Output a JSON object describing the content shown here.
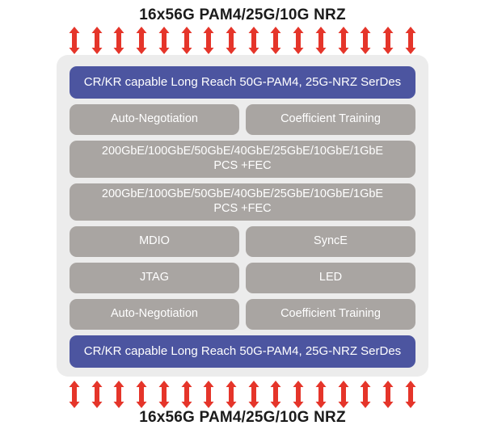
{
  "labels": {
    "top": "16x56G PAM4/25G/10G NRZ",
    "bottom": "16x56G PAM4/25G/10G NRZ"
  },
  "arrows": {
    "icon": "double-arrow-up-down-icon",
    "count": 16,
    "color": "#e5352a",
    "top_row_count": 16,
    "bottom_row_count": 16
  },
  "colors": {
    "serdes_block": "#4c55a0",
    "gray_block": "#a9a5a2",
    "chip_background": "#ececec",
    "arrow_red": "#e5352a",
    "page_background": "#ffffff",
    "label_text": "#1b1b1b",
    "block_text": "#ffffff"
  },
  "chip": {
    "rows": [
      {
        "type": "serdes",
        "blocks": [
          {
            "label": "CR/KR capable Long Reach 50G-PAM4, 25G-NRZ SerDes"
          }
        ]
      },
      {
        "type": "pair",
        "blocks": [
          {
            "label": "Auto-Negotiation"
          },
          {
            "label": "Coefficient Training"
          }
        ]
      },
      {
        "type": "full",
        "blocks": [
          {
            "label": "200GbE/100GbE/50GbE/40GbE/25GbE/10GbE/1GbE",
            "label_line2": "PCS +FEC"
          }
        ]
      },
      {
        "type": "full",
        "blocks": [
          {
            "label": "200GbE/100GbE/50GbE/40GbE/25GbE/10GbE/1GbE",
            "label_line2": "PCS +FEC"
          }
        ]
      },
      {
        "type": "pair",
        "blocks": [
          {
            "label": "MDIO"
          },
          {
            "label": "SyncE"
          }
        ]
      },
      {
        "type": "pair",
        "blocks": [
          {
            "label": "JTAG"
          },
          {
            "label": "LED"
          }
        ]
      },
      {
        "type": "pair",
        "blocks": [
          {
            "label": "Auto-Negotiation"
          },
          {
            "label": "Coefficient Training"
          }
        ]
      },
      {
        "type": "serdes",
        "blocks": [
          {
            "label": "CR/KR capable Long Reach 50G-PAM4, 25G-NRZ SerDes"
          }
        ]
      }
    ]
  }
}
